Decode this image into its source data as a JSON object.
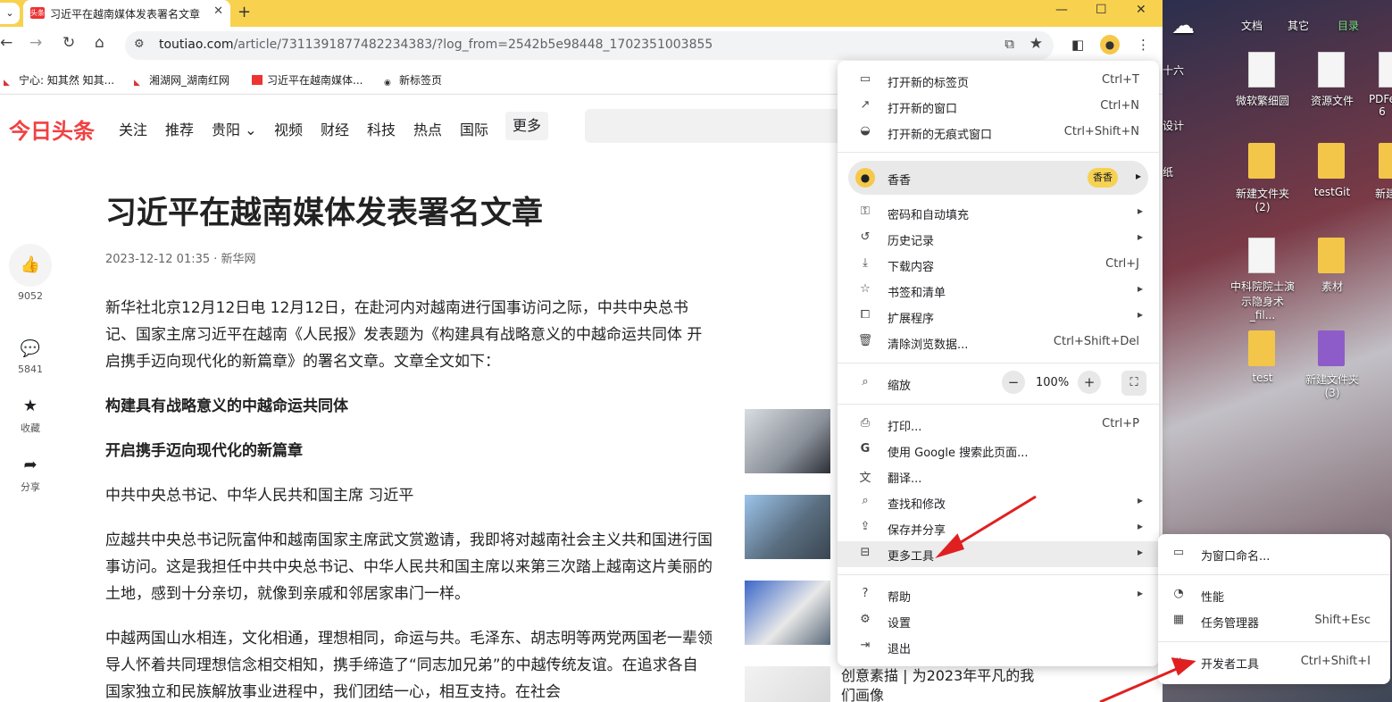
{
  "browser": {
    "tab": {
      "favicon": "头条",
      "title": "习近平在越南媒体发表署名文章",
      "close": "✕"
    },
    "newtab": "+",
    "window_controls": {
      "minimize": "—",
      "maximize": "☐",
      "close": "✕"
    },
    "url": {
      "host": "toutiao.com",
      "path": "/article/7311391877482234383/?log_from=2542b5e98448_1702351003855"
    },
    "bookmarks": [
      {
        "label": "宁心: 知其然 知其..."
      },
      {
        "label": "湘湖网_湖南红网"
      },
      {
        "label": "习近平在越南媒体..."
      },
      {
        "label": "新标签页"
      }
    ]
  },
  "site": {
    "logo": "今日头条",
    "nav": [
      "关注",
      "推荐",
      "贵阳 ⌄",
      "视频",
      "财经",
      "科技",
      "热点",
      "国际"
    ],
    "more": "更多"
  },
  "sidebar": {
    "likes": "9052",
    "comments": "5841",
    "favorite": "收藏",
    "share": "分享"
  },
  "article": {
    "title": "习近平在越南媒体发表署名文章",
    "meta": "2023-12-12 01:35 · 新华网",
    "paragraphs": [
      "新华社北京12月12日电 12月12日，在赴河内对越南进行国事访问之际，中共中央总书记、国家主席习近平在越南《人民报》发表题为《构建具有战略意义的中越命运共同体 开启携手迈向现代化的新篇章》的署名文章。文章全文如下：",
      "构建具有战略意义的中越命运共同体",
      "开启携手迈向现代化的新篇章",
      "中共中央总书记、中华人民共和国主席 习近平",
      "应越共中央总书记阮富仲和越南国家主席武文赏邀请，我即将对越南社会主义共和国进行国事访问。这是我担任中共中央总书记、中华人民共和国主席以来第三次踏上越南这片美丽的土地，感到十分亲切，就像到亲戚和邻居家串门一样。",
      "中越两国山水相连，文化相通，理想相同，命运与共。毛泽东、胡志明等两党两国老一辈领导人怀着共同理想信念相交相知，携手缔造了“同志加兄弟”的中越传统友谊。在追求各自国家独立和民族解放事业进程中，我们团结一心，相互支持。在社会"
    ],
    "related_caption": "创意素描 | 为2023年平凡的我们画像"
  },
  "menu": {
    "new_tab": {
      "label": "打开新的标签页",
      "shortcut": "Ctrl+T"
    },
    "new_window": {
      "label": "打开新的窗口",
      "shortcut": "Ctrl+N"
    },
    "incognito": {
      "label": "打开新的无痕式窗口",
      "shortcut": "Ctrl+Shift+N"
    },
    "profile": {
      "name": "香香",
      "chip": "香香"
    },
    "passwords": {
      "label": "密码和自动填充"
    },
    "history": {
      "label": "历史记录"
    },
    "downloads": {
      "label": "下载内容",
      "shortcut": "Ctrl+J"
    },
    "bookmarks": {
      "label": "书签和清单"
    },
    "extensions": {
      "label": "扩展程序"
    },
    "clear": {
      "label": "清除浏览数据...",
      "shortcut": "Ctrl+Shift+Del"
    },
    "zoom": {
      "label": "缩放",
      "value": "100%",
      "minus": "−",
      "plus": "+"
    },
    "print": {
      "label": "打印...",
      "shortcut": "Ctrl+P"
    },
    "google": {
      "label": "使用 Google 搜索此页面..."
    },
    "translate": {
      "label": "翻译..."
    },
    "find": {
      "label": "查找和修改"
    },
    "save": {
      "label": "保存并分享"
    },
    "more_tools": {
      "label": "更多工具"
    },
    "help": {
      "label": "帮助"
    },
    "settings": {
      "label": "设置"
    },
    "exit": {
      "label": "退出"
    }
  },
  "submenu": {
    "name_window": {
      "label": "为窗口命名..."
    },
    "performance": {
      "label": "性能"
    },
    "task_manager": {
      "label": "任务管理器",
      "shortcut": "Shift+Esc"
    },
    "devtools": {
      "label": "开发者工具",
      "shortcut": "Ctrl+Shift+I"
    }
  },
  "desktop": {
    "tabs": [
      "文档",
      "其它",
      "目录"
    ],
    "side_texts": [
      "十六",
      "设计",
      "纸"
    ],
    "icons": [
      {
        "label": "微软繁细圆"
      },
      {
        "label": "资源文件"
      },
      {
        "label": "PDFe 6"
      },
      {
        "label": "新建文件夹 (2)"
      },
      {
        "label": "testGit"
      },
      {
        "label": "新建"
      },
      {
        "label": "中科院院士演示隐身术_fil..."
      },
      {
        "label": "素材"
      },
      {
        "label": "test"
      },
      {
        "label": "新建文件夹 (3)"
      }
    ]
  },
  "colors": {
    "accent": "#f04142",
    "tabbar": "#f8d24f",
    "arrow": "#e02020"
  }
}
